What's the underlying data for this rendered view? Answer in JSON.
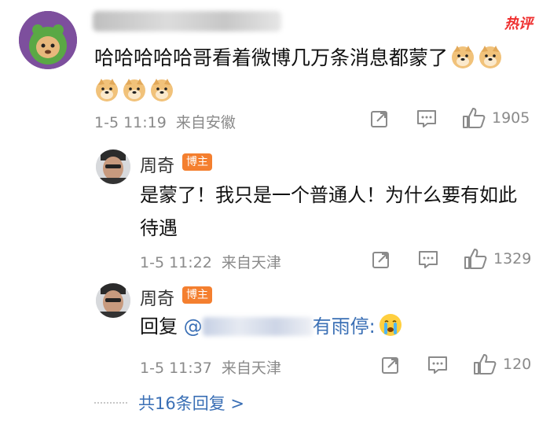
{
  "hot_label": "热评",
  "main_comment": {
    "text": "哈哈哈哈哈哥看着微博几万条消息都蒙了",
    "time": "1-5 11:19",
    "source": "来自安徽",
    "likes": "1905"
  },
  "reply1": {
    "username": "周奇",
    "badge": "博主",
    "text": "是蒙了！我只是一个普通人！为什么要有如此待遇",
    "time": "1-5 11:22",
    "source": "来自天津",
    "likes": "1329"
  },
  "reply2": {
    "username": "周奇",
    "badge": "博主",
    "prefix": "回复",
    "mention_at": "@",
    "mention_tail": "有雨停:",
    "time": "1-5 11:37",
    "source": "来自天津",
    "likes": "120"
  },
  "more_replies": "共16条回复 >",
  "colors": {
    "link": "#3a6fb5",
    "badge": "#f47f2f",
    "hot": "#ef2f2f"
  }
}
